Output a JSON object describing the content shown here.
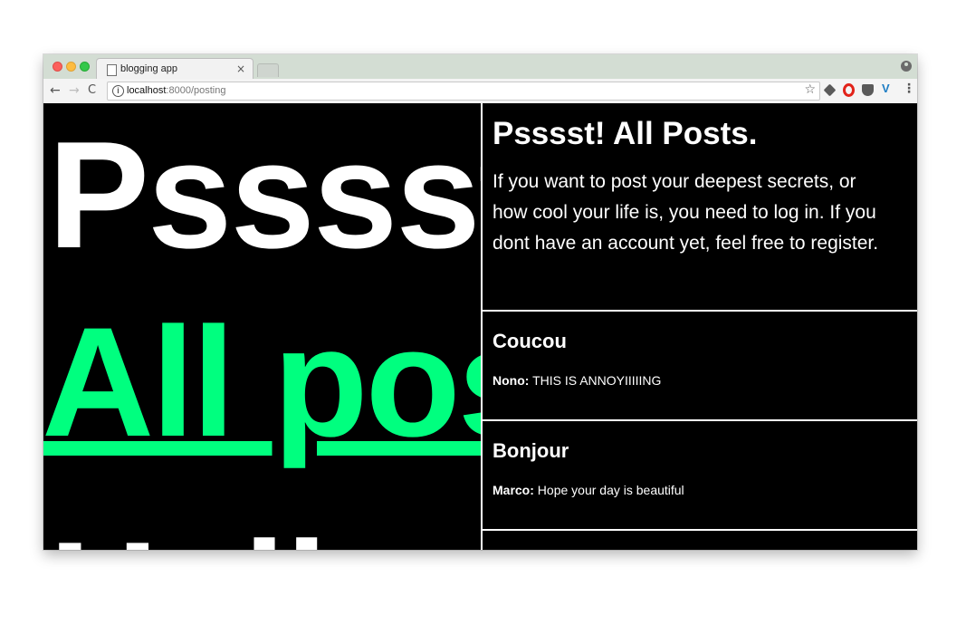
{
  "browser": {
    "tab_title": "blogging app",
    "tab_close": "×",
    "url_host": "localhost",
    "url_path": ":8000/posting",
    "back_glyph": "←",
    "forward_glyph": "→",
    "reload_glyph": "C",
    "info_glyph": "i",
    "star_glyph": "☆",
    "ext_v_label": "V",
    "menu_glyph": "⋮"
  },
  "left": {
    "big_title": "Psssst!",
    "big_link": "All posts",
    "big_next": "Hello"
  },
  "right": {
    "title": "Psssst! All Posts.",
    "intro": "If you want to post your deepest secrets, or how cool your life is, you need to log in. If you dont have an account yet, feel free to register.",
    "posts": [
      {
        "title": "Coucou",
        "author": "Nono:",
        "body": " THIS IS ANNOYIIIIING"
      },
      {
        "title": "Bonjour",
        "author": "Marco:",
        "body": " Hope your day is beautiful"
      }
    ]
  },
  "colors": {
    "accent_green": "#00ff7f",
    "page_background": "#000000",
    "text": "#ffffff"
  }
}
